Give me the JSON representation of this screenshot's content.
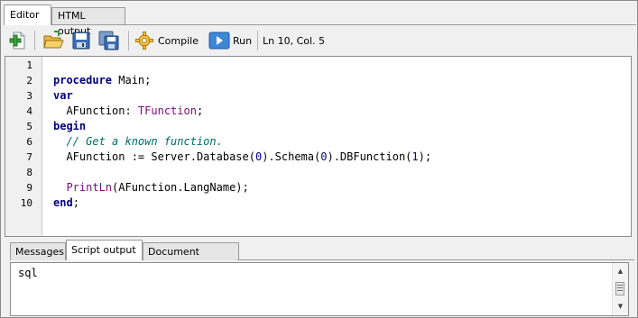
{
  "tabs_top": [
    "Editor",
    "HTML output"
  ],
  "toolbar": {
    "compile_label": "Compile",
    "run_label": "Run",
    "cursor_position": "Ln 10, Col. 5"
  },
  "editor": {
    "line_numbers": [
      "1",
      "2",
      "3",
      "4",
      "5",
      "6",
      "7",
      "8",
      "9",
      "10"
    ],
    "code": [
      [],
      [
        {
          "t": "procedure",
          "c": "kw"
        },
        {
          "t": " Main;",
          "c": ""
        }
      ],
      [
        {
          "t": "var",
          "c": "kw"
        }
      ],
      [
        {
          "t": "  AFunction: ",
          "c": ""
        },
        {
          "t": "TFunction",
          "c": "typ"
        },
        {
          "t": ";",
          "c": ""
        }
      ],
      [
        {
          "t": "begin",
          "c": "kw"
        }
      ],
      [
        {
          "t": "  // Get a known function.",
          "c": "cm"
        }
      ],
      [
        {
          "t": "  AFunction := Server.Database(",
          "c": ""
        },
        {
          "t": "0",
          "c": "num"
        },
        {
          "t": ").Schema(",
          "c": ""
        },
        {
          "t": "0",
          "c": "num"
        },
        {
          "t": ").DBFunction(",
          "c": ""
        },
        {
          "t": "1",
          "c": "num"
        },
        {
          "t": ");",
          "c": ""
        }
      ],
      [],
      [
        {
          "t": "  ",
          "c": ""
        },
        {
          "t": "PrintLn",
          "c": "fn"
        },
        {
          "t": "(AFunction.LangName);",
          "c": ""
        }
      ],
      [
        {
          "t": "end",
          "c": "kw"
        },
        {
          "t": ";",
          "c": ""
        }
      ]
    ]
  },
  "tabs_bottom": [
    "Messages",
    "Script output",
    "Document settings"
  ],
  "output": {
    "text": "sql"
  },
  "icons": {
    "new": "add-document-icon",
    "open": "open-folder-icon",
    "save": "save-disk-icon",
    "save_all": "save-all-icon",
    "compile": "gear-icon",
    "run": "play-icon"
  },
  "colors": {
    "keyword": "#00007f",
    "comment": "#006b6b",
    "type": "#7a0a7a",
    "number": "#000080"
  }
}
